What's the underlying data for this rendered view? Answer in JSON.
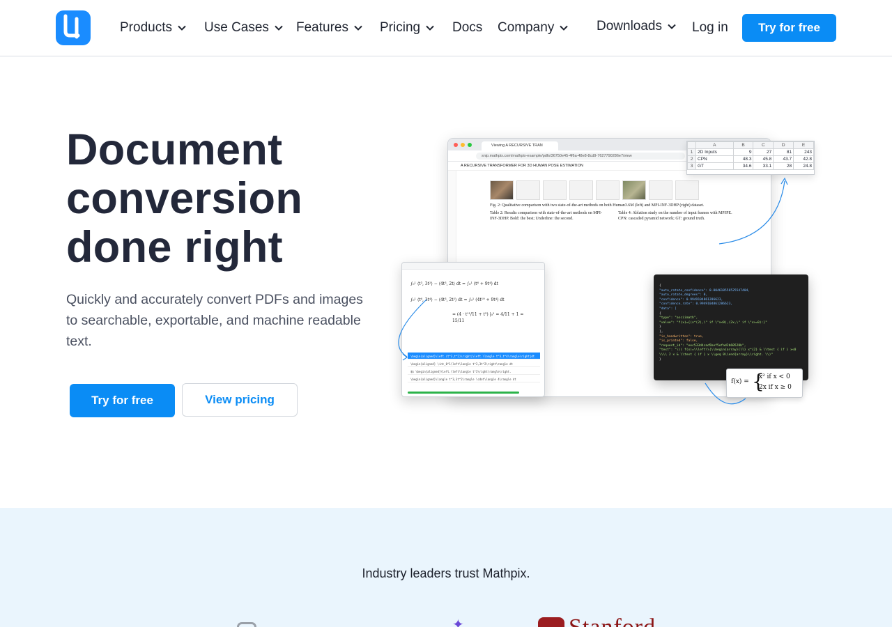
{
  "header": {
    "logo_icon": "mathpix-logo-icon",
    "nav": [
      {
        "label": "Products",
        "has_dropdown": true
      },
      {
        "label": "Use Cases",
        "has_dropdown": true
      },
      {
        "label": "Features",
        "has_dropdown": true
      },
      {
        "label": "Pricing",
        "has_dropdown": true
      },
      {
        "label": "Docs",
        "has_dropdown": false
      },
      {
        "label": "Company",
        "has_dropdown": true
      }
    ],
    "downloads": {
      "label": "Downloads",
      "has_dropdown": true
    },
    "login": "Log in",
    "cta": "Try for free"
  },
  "hero": {
    "title_lines": [
      "Document",
      "conversion",
      "done right"
    ],
    "subtitle": "Quickly and accurately convert PDFs and images to searchable, exportable, and machine readable text.",
    "primary_button": "Try for free",
    "secondary_button": "View pricing"
  },
  "illustration": {
    "browser_tab": "Viewing A RECURSIVE TRAN",
    "browser_url": "snip.mathpix.com/mathpix-example/pdfs/36750e45-4f6a-48e8-8cd9-7627790286e7/view",
    "doc_title": "A RECURSIVE TRANSFORMER FOR 3D HUMAN POSE ESTIMATION",
    "fig_caption": "Fig. 2: Qualitative comparison with two state-of-the-art methods on both Human3.6M (left) and MPI-INF-3DHP (right) dataset.",
    "table2_caption": "Table 2: Results comparison with state-of-the-art methods on MPI-INF-3DHP. Bold: the best; Underline: the second.",
    "table4_caption": "Table 4: Ablation study on the number of input frames with MPJPE. CPN: cascaded pyramid network; GT: ground truth.",
    "spreadsheet": {
      "columns": [
        "",
        "A",
        "B",
        "C",
        "D",
        "E"
      ],
      "rows": [
        [
          "1",
          "2D Inputs",
          "9",
          "27",
          "81",
          "243"
        ],
        [
          "2",
          "CPN",
          "48.3",
          "45.8",
          "43.7",
          "42.8"
        ],
        [
          "3",
          "GT",
          "34.6",
          "33.1",
          "28",
          "24.8"
        ]
      ]
    },
    "json_lines": [
      "{",
      "  \"auto_rotate_confidence\": 0.004618556525547404,",
      "  \"auto_rotate_degrees\": 0,",
      "  \"confidence\": 0.9949104861286623,",
      "  \"confidence_rate\": 0.9949104861286623,",
      "  \"data\": [",
      "    {",
      "      \"type\": \"asciimath\",",
      "      \"value\": \"f(x)={(x^(2),\\\" if \\\"x<0),(2x,\\\" if \\\"x>=0):}\"",
      "    }",
      "  ],",
      "  \"is_handwritten\": true,",
      "  \"is_printed\": false,",
      "  \"request_id\": \"eec533d4cad5bef5efad2b60528b\",",
      "  \"text\": \"\\\\( f(x)=\\\\left\\\\{\\\\begin{array}{ll} x^{2} & \\\\text { if } x<0 \\\\\\\\ 2 x & \\\\text { if } x \\\\geq 0\\\\end{array}\\\\right. \\\\)\"",
      "}"
    ],
    "formula": {
      "lhs": "f(x) =",
      "case1": "x² if x < 0",
      "case2": "2x if x ≥ 0"
    },
    "snip_rows": [
      "\\begin{aligned}\\left.(t^3,t^2)\\right|\\left.\\langle t^3,t^4\\rangle\\right|dt",
      "\\begin{aligned} \\int_0^1\\left\\langle t^3,3t^2\\right\\rangle dt",
      "$$ \\begin{aligned}\\left.\\left\\langle t^3\\right\\rangle\\right.",
      "\\begin{aligned}\\langle t^3,3t^2\\rangle \\cdot\\langle 4\\rangle dt"
    ]
  },
  "trust": {
    "title": "Industry leaders trust Mathpix.",
    "logos": [
      "star-logo",
      "Stanford"
    ]
  },
  "colors": {
    "primary": "#0a8cf5",
    "heading": "#23283a",
    "body_text": "#4a5060",
    "trust_bg": "#eaf5fd",
    "stanford_red": "#8c1515"
  }
}
